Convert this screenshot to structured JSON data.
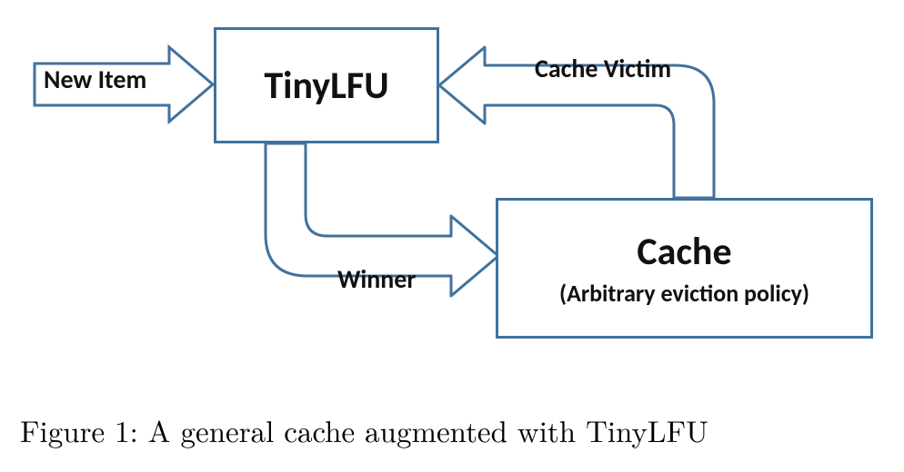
{
  "blocks": {
    "tinylfu": {
      "title": "TinyLFU"
    },
    "cache": {
      "title": "Cache",
      "subtitle": "(Arbitrary eviction policy)"
    }
  },
  "arrows": {
    "new_item": {
      "label": "New Item",
      "from": "external-left",
      "to": "tinylfu"
    },
    "cache_victim": {
      "label": "Cache Victim",
      "from": "cache",
      "to": "tinylfu"
    },
    "winner": {
      "label": "Winner",
      "from": "tinylfu",
      "to": "cache"
    }
  },
  "caption": "Figure 1: A general cache augmented with TinyLFU",
  "colors": {
    "stroke": "#40729d",
    "bg": "#ffffff",
    "text": "#000000"
  }
}
